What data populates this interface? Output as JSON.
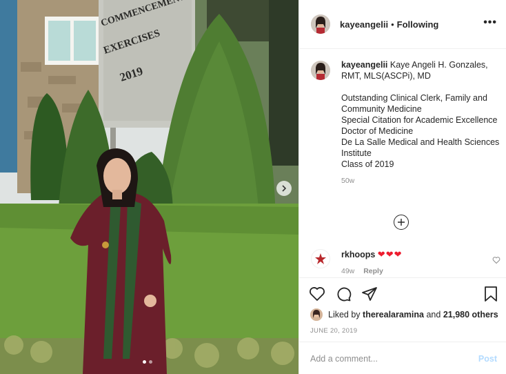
{
  "header": {
    "username": "kayeangelii",
    "separator": "•",
    "follow_label": "Following",
    "more_label": "•••"
  },
  "photo": {
    "sign_lines": [
      "COMMENCEMENT",
      "EXERCISES",
      "2019"
    ],
    "carousel_count": 2,
    "carousel_active": 1
  },
  "caption": {
    "username": "kayeangelii",
    "intro": "Kaye Angeli H. Gonzales, RMT, MLS(ASCPi), MD",
    "lines": [
      "Outstanding Clinical Clerk, Family and Community Medicine",
      "Special Citation for Academic Excellence",
      "Doctor of Medicine",
      "De La Salle Medical and Health Sciences Institute",
      "Class of 2019"
    ],
    "age": "50w"
  },
  "comment": {
    "username": "rkhoops",
    "text": "❤❤❤",
    "age": "49w",
    "reply_label": "Reply"
  },
  "actions": {
    "liked_by_prefix": "Liked by",
    "liked_by_user": "therealaramina",
    "liked_by_and": "and",
    "likes_count": "21,980 others",
    "date": "JUNE 20, 2019"
  },
  "add_comment": {
    "placeholder": "Add a comment...",
    "post_label": "Post"
  },
  "colors": {
    "text": "#262626",
    "muted": "#8e8e8e",
    "post_disabled": "#b3dbff",
    "heart_red": "#ed1c2e",
    "border": "#efefef"
  }
}
